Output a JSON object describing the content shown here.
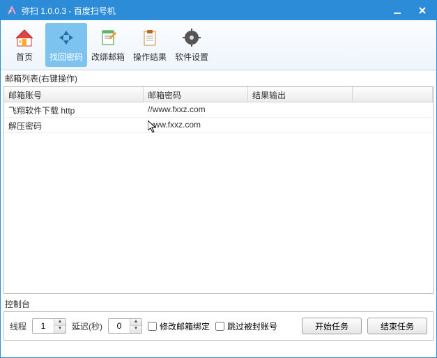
{
  "window": {
    "title": "弥扫 1.0.0.3  -  百度扫号机"
  },
  "toolbar": {
    "items": [
      {
        "label": "首页"
      },
      {
        "label": "找回密码"
      },
      {
        "label": "改绑邮箱"
      },
      {
        "label": "操作结果"
      },
      {
        "label": "软件设置"
      }
    ]
  },
  "table": {
    "caption": "邮箱列表(右键操作)",
    "headers": [
      "邮箱账号",
      "邮箱密码",
      "结果输出",
      ""
    ],
    "rows": [
      {
        "account": "飞翔软件下载 http",
        "password": "//www.fxxz.com",
        "result": ""
      },
      {
        "account": "解压密码",
        "password": "www.fxxz.com",
        "result": ""
      }
    ]
  },
  "control": {
    "caption": "控制台",
    "threads_label": "线程",
    "threads_value": "1",
    "delay_label": "延迟(秒)",
    "delay_value": "0",
    "checkbox_modify": "修改邮箱绑定",
    "checkbox_skip": "跳过被封账号",
    "start_label": "开始任务",
    "stop_label": "结束任务"
  }
}
